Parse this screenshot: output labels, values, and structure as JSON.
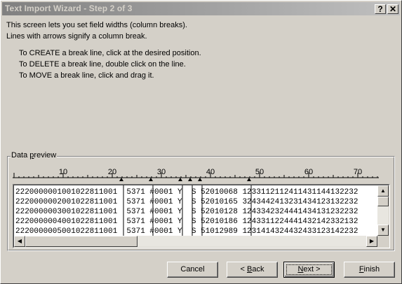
{
  "window": {
    "title": "Text Import Wizard - Step 2 of 3",
    "help_glyph": "?",
    "close_glyph": "✕"
  },
  "intro": {
    "line1": "This screen lets you set field widths (column breaks).",
    "line2": "Lines with arrows signify a column break."
  },
  "instructions": [
    "To CREATE a break line, click at the desired position.",
    "To DELETE a break line, double click on the line.",
    "To MOVE a break line, click and drag it."
  ],
  "preview": {
    "label": "Data preview",
    "ruler_labels": [
      "10",
      "20",
      "30",
      "40",
      "50",
      "60",
      "70"
    ],
    "break_columns": [
      22,
      28,
      34,
      36,
      38,
      48
    ],
    "rows": [
      "2220000001001022811001  5371 #0001 Y  S 52010068 1233112112411431144132232",
      "2220000002001022811001  5371 #0001 Y  S 52010165 3243442413231434123132232",
      "2220000003001022811001  5371 #0001 Y  S 52010128 1243342324441434131232232",
      "2220000004001022811001  5371 #0001 Y  S 52010186 1243311224441432142332132",
      "2220000005001022811001  5371 #0001 Y  S 51012989 1231414324432433123142232"
    ]
  },
  "buttons": {
    "cancel": "Cancel",
    "back": "< Back",
    "next": "Next >",
    "finish": "Finish"
  }
}
